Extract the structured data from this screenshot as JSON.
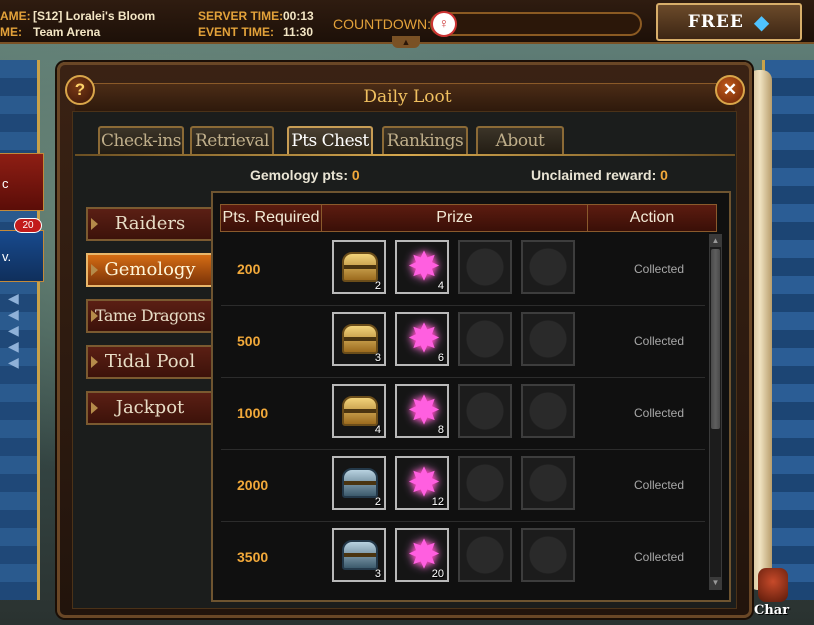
{
  "topbar": {
    "server_label": "AME:",
    "server_value": "[S12] Loralei's Bloom",
    "game_label": "ME:",
    "game_value": "Team Arena",
    "server_time_label": "SERVER TIME:",
    "server_time_value": "00:13",
    "event_time_label": "EVENT TIME:",
    "event_time_value": "11:30",
    "countdown_label": "COUNTDOWN:",
    "free_label": "FREE"
  },
  "left_peek": {
    "red_text": "c",
    "badge": "20",
    "blue_text": "v."
  },
  "dialog": {
    "title": "Daily Loot",
    "help": "?",
    "close": "✕"
  },
  "tabs": [
    {
      "label": "Check-ins"
    },
    {
      "label": "Retrieval"
    },
    {
      "label": "Pts Chest"
    },
    {
      "label": "Rankings"
    },
    {
      "label": "About"
    }
  ],
  "info": {
    "gemology_label": "Gemology pts:",
    "gemology_value": "0",
    "unclaimed_label": "Unclaimed reward:",
    "unclaimed_value": "0"
  },
  "side_menu": [
    {
      "label": "Raiders"
    },
    {
      "label": "Gemology"
    },
    {
      "label": "Tame Dragons"
    },
    {
      "label": "Tidal Pool"
    },
    {
      "label": "Jackpot"
    }
  ],
  "table": {
    "headers": {
      "pts": "Pts. Required",
      "prize": "Prize",
      "action": "Action"
    },
    "rows": [
      {
        "pts": "200",
        "chest_qty": "2",
        "gem_qty": "4",
        "action": "Collected"
      },
      {
        "pts": "500",
        "chest_qty": "3",
        "gem_qty": "6",
        "action": "Collected"
      },
      {
        "pts": "1000",
        "chest_qty": "4",
        "gem_qty": "8",
        "action": "Collected"
      },
      {
        "pts": "2000",
        "chest_qty": "2",
        "gem_qty": "12",
        "action": "Collected"
      },
      {
        "pts": "3500",
        "chest_qty": "3",
        "gem_qty": "20",
        "action": "Collected"
      }
    ]
  },
  "char_label": "Char",
  "icons": {
    "chest_gold": "gold-chest-icon",
    "chest_silver": "silver-chest-icon",
    "gem": "pink-gem-icon",
    "diamond": "diamond-icon"
  },
  "colors": {
    "accent": "#f2a93a",
    "active_tab_text": "#ffffff",
    "gem": "#ff5fe0"
  }
}
